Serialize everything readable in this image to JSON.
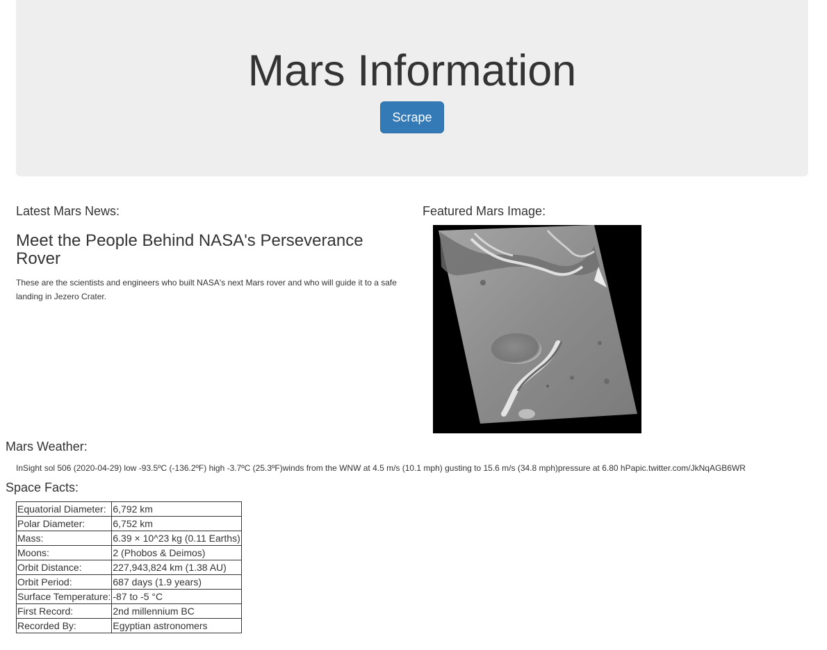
{
  "jumbotron": {
    "title": "Mars Information",
    "scrape_label": "Scrape"
  },
  "news": {
    "heading": "Latest Mars News:",
    "title": "Meet the People Behind NASA's Perseverance Rover",
    "paragraph": "These are the scientists and engineers who built NASA's next Mars rover and who will guide it to a safe landing in Jezero Crater."
  },
  "featured_image": {
    "heading": "Featured Mars Image:",
    "description": "grayscale orbital image of Martian surface with crater and channel"
  },
  "weather": {
    "heading": "Mars Weather:",
    "text": "InSight sol 506 (2020-04-29) low -93.5ºC (-136.2ºF) high -3.7ºC (25.3ºF)winds from the WNW at 4.5 m/s (10.1 mph) gusting to 15.6 m/s (34.8 mph)pressure at 6.80 hPapic.twitter.com/JkNqAGB6WR"
  },
  "facts": {
    "heading": "Space Facts:",
    "rows": [
      {
        "key": "Equatorial Diameter:",
        "value": "6,792 km"
      },
      {
        "key": "Polar Diameter:",
        "value": "6,752 km"
      },
      {
        "key": "Mass:",
        "value": "6.39 × 10^23 kg (0.11 Earths)"
      },
      {
        "key": "Moons:",
        "value": "2 (Phobos & Deimos)"
      },
      {
        "key": "Orbit Distance:",
        "value": "227,943,824 km (1.38 AU)"
      },
      {
        "key": "Orbit Period:",
        "value": "687 days (1.9 years)"
      },
      {
        "key": "Surface Temperature:",
        "value": "-87 to -5 °C"
      },
      {
        "key": "First Record:",
        "value": "2nd millennium BC"
      },
      {
        "key": "Recorded By:",
        "value": "Egyptian astronomers"
      }
    ]
  }
}
